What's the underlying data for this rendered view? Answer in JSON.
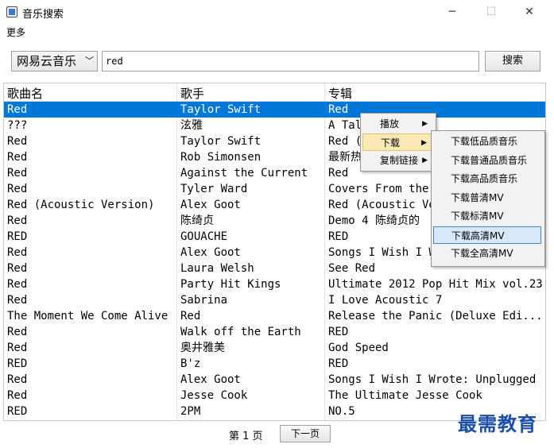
{
  "window": {
    "title": "音乐搜索",
    "minimize": "─",
    "maximize": "☐",
    "close": "✕"
  },
  "menu": {
    "more": "更多"
  },
  "search": {
    "source": "网易云音乐",
    "query": "red",
    "button": "搜索"
  },
  "table": {
    "columns": [
      "歌曲名",
      "歌手",
      "专辑"
    ],
    "selected_row": 0,
    "rows": [
      [
        "Red",
        "Taylor Swift",
        "Red"
      ],
      [
        "???",
        "泫雅",
        "A Talk"
      ],
      [
        "Red",
        "Taylor Swift",
        "Red (Deluxe Edition)"
      ],
      [
        "Red",
        "Rob Simonsen",
        "最新热歌慢摇"
      ],
      [
        "Red",
        "Against the Current",
        "Red"
      ],
      [
        "Red",
        "Tyler Ward",
        "Covers From the Heart"
      ],
      [
        "Red (Acoustic Version)",
        "Alex Goot",
        "Red (Acoustic Version)"
      ],
      [
        "Red",
        "陈绮贞",
        "Demo 4 陈绮贞的"
      ],
      [
        "RED",
        "GOUACHE",
        "RED"
      ],
      [
        "Red",
        "Alex Goot",
        "Songs I Wish I Wrote"
      ],
      [
        "Red",
        "Laura Welsh",
        "See Red"
      ],
      [
        "Red",
        "Party Hit Kings",
        "Ultimate 2012 Pop Hit Mix vol.23"
      ],
      [
        "Red",
        "Sabrina",
        "I Love Acoustic 7"
      ],
      [
        "The Moment We Come Alive",
        "Red",
        "Release the Panic (Deluxe Edi..."
      ],
      [
        "Red",
        "Walk off the Earth",
        "RED"
      ],
      [
        "Red",
        "奥井雅美",
        "God Speed"
      ],
      [
        "RED",
        "B'z",
        "RED"
      ],
      [
        "Red",
        "Alex Goot",
        "Songs I Wish I Wrote: Unplugged"
      ],
      [
        "Red",
        "Jesse Cook",
        "The Ultimate Jesse Cook"
      ],
      [
        "RED",
        "2PM",
        "NO.5"
      ]
    ]
  },
  "context_menu": {
    "items": [
      {
        "label": "播放",
        "has_submenu": true
      },
      {
        "label": "下载",
        "has_submenu": true
      },
      {
        "label": "复制链接",
        "has_submenu": true
      }
    ],
    "highlighted": 1
  },
  "download_submenu": {
    "items": [
      "下载低品质音乐",
      "下载普通品质音乐",
      "下载高品质音乐",
      "下载普清MV",
      "下载标清MV",
      "下载高清MV",
      "下载全高清MV"
    ],
    "highlighted": 5
  },
  "pager": {
    "label": "第 1 页",
    "next": "下一页"
  },
  "watermark": "最需教育"
}
